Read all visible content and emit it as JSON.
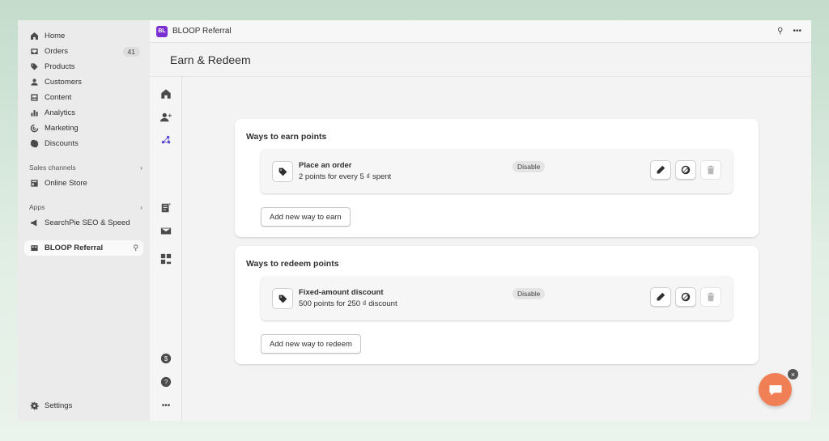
{
  "sidebar": {
    "nav": [
      {
        "label": "Home",
        "icon": "home-icon"
      },
      {
        "label": "Orders",
        "icon": "orders-icon",
        "count": "41"
      },
      {
        "label": "Products",
        "icon": "tag-icon"
      },
      {
        "label": "Customers",
        "icon": "person-icon"
      },
      {
        "label": "Content",
        "icon": "content-icon"
      },
      {
        "label": "Analytics",
        "icon": "chart-icon"
      },
      {
        "label": "Marketing",
        "icon": "target-icon"
      },
      {
        "label": "Discounts",
        "icon": "discount-icon"
      }
    ],
    "sales_channels_heading": "Sales channels",
    "online_store": "Online Store",
    "apps_heading": "Apps",
    "searchpie": "SearchPie SEO & Speed",
    "bloop": "BLOOP Referral",
    "settings": "Settings"
  },
  "topbar": {
    "app_name": "BLOOP Referral",
    "logo_text": "BL"
  },
  "page": {
    "title": "Earn & Redeem"
  },
  "earn": {
    "title": "Ways to earn points",
    "rule_name": "Place an order",
    "rule_desc": "2 points for every 5 ₫ spent",
    "badge": "Disable",
    "add_label": "Add new way to earn"
  },
  "redeem": {
    "title": "Ways to redeem points",
    "rule_name": "Fixed-amount discount",
    "rule_desc": "500 points for 250 ₫ discount",
    "badge": "Disable",
    "add_label": "Add new way to redeem"
  },
  "colors": {
    "brand": "#7a2fd1",
    "chat": "#f07f55",
    "background": "#c4dccb"
  }
}
